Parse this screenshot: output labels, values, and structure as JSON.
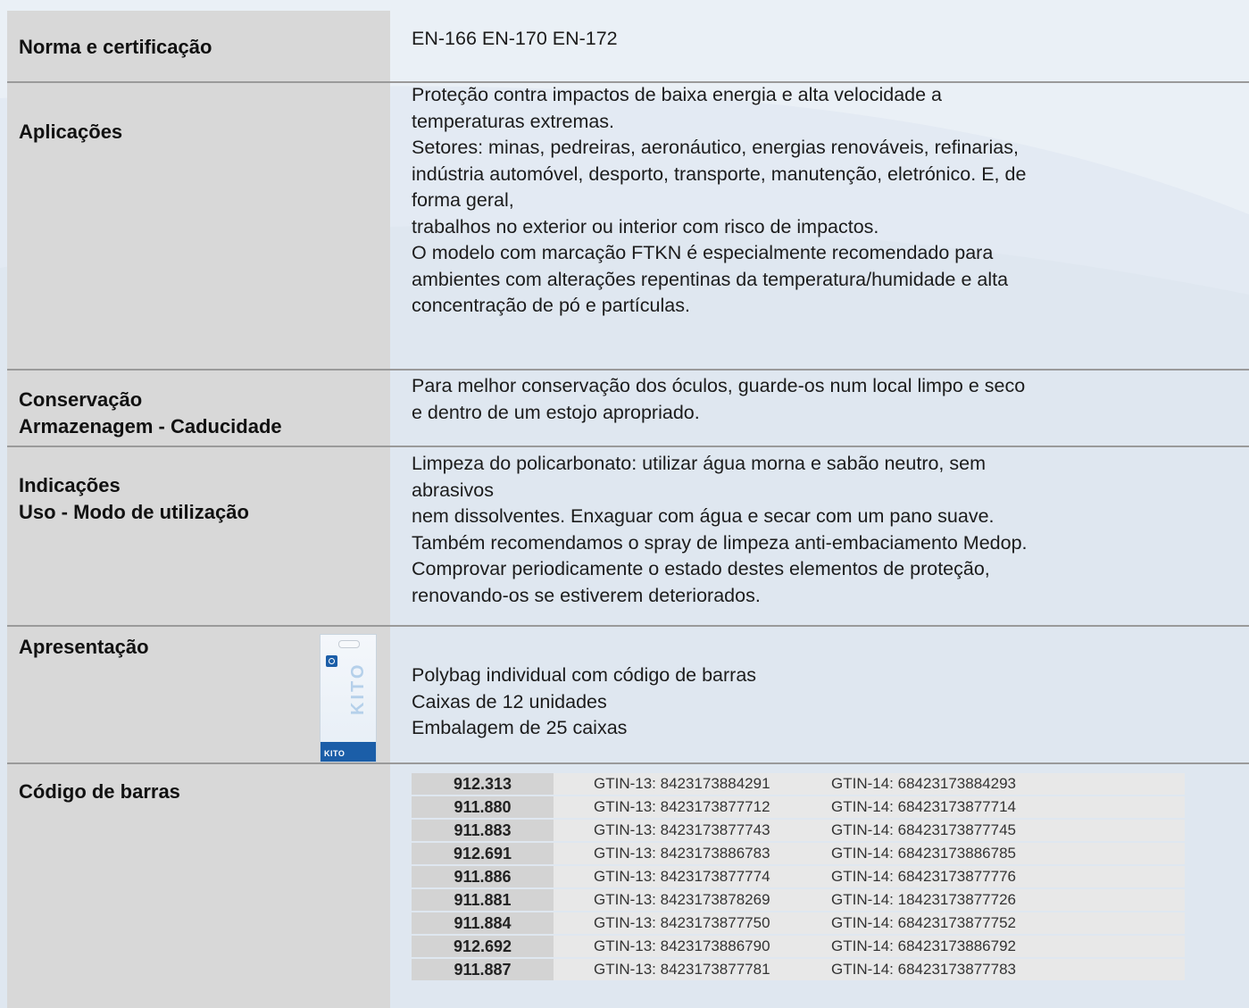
{
  "colors": {
    "label_bg": "#d8d8d8",
    "value_bg": "#e4ebf3",
    "divider": "#9a9a9a",
    "code_cell": "#d3d3d3",
    "gtin_cell": "#e8e8e8",
    "brand_blue": "#1b5ea8"
  },
  "rows": {
    "norma": {
      "label": "Norma e certificação",
      "value": "EN-166  EN-170  EN-172"
    },
    "aplicacoes": {
      "label": "Aplicações",
      "lines": [
        "Proteção contra impactos de baixa energia e alta velocidade a",
        "temperaturas extremas.",
        "Setores: minas, pedreiras, aeronáutico, energias renováveis, refinarias,",
        "indústria automóvel, desporto, transporte, manutenção, eletrónico. E, de",
        "forma geral,",
        "trabalhos no exterior ou interior com risco de impactos.",
        "O modelo com marcação FTKN é especialmente recomendado para",
        "ambientes com alterações repentinas da temperatura/humidade e alta",
        "concentração de pó e partículas."
      ]
    },
    "conservacao": {
      "label_1": "Conservação",
      "label_2": "Armazenagem - Caducidade",
      "lines": [
        "Para melhor conservação dos óculos, guarde-os num local limpo e seco",
        "e dentro de um estojo apropriado."
      ]
    },
    "indicacoes": {
      "label_1": "Indicações",
      "label_2": "Uso - Modo de utilização",
      "lines": [
        "Limpeza do policarbonato: utilizar água morna e sabão neutro, sem",
        "abrasivos",
        "nem dissolventes. Enxaguar com água e secar com um pano suave.",
        "Também recomendamos o spray de limpeza anti-embaciamento Medop.",
        "Comprovar periodicamente o estado destes elementos de proteção,",
        "renovando-os se estiverem deteriorados."
      ]
    },
    "apresentacao": {
      "label": "Apresentação",
      "lines": [
        "Polybag individual com código de barras",
        "Caixas de 12 unidades",
        "Embalagem de 25 caixas"
      ],
      "package_text": "KITO",
      "package_brand": "KITO"
    },
    "codigo": {
      "label": "Código de barras",
      "barcodes": [
        {
          "code": "912.313",
          "gtin13": "GTIN-13: 8423173884291",
          "gtin14": "GTIN-14:  68423173884293"
        },
        {
          "code": "911.880",
          "gtin13": "GTIN-13: 8423173877712",
          "gtin14": "GTIN-14:  68423173877714"
        },
        {
          "code": "911.883",
          "gtin13": "GTIN-13: 8423173877743",
          "gtin14": "GTIN-14:  68423173877745"
        },
        {
          "code": "912.691",
          "gtin13": "GTIN-13: 8423173886783",
          "gtin14": "GTIN-14:  68423173886785"
        },
        {
          "code": "911.886",
          "gtin13": "GTIN-13: 8423173877774",
          "gtin14": "GTIN-14:  68423173877776"
        },
        {
          "code": "911.881",
          "gtin13": "GTIN-13: 8423173878269",
          "gtin14": "GTIN-14:  18423173877726"
        },
        {
          "code": "911.884",
          "gtin13": "GTIN-13: 8423173877750",
          "gtin14": "GTIN-14:  68423173877752"
        },
        {
          "code": "912.692",
          "gtin13": "GTIN-13: 8423173886790",
          "gtin14": "GTIN-14:  68423173886792"
        },
        {
          "code": "911.887",
          "gtin13": "GTIN-13: 8423173877781",
          "gtin14": "GTIN-14:  68423173877783"
        }
      ]
    }
  }
}
